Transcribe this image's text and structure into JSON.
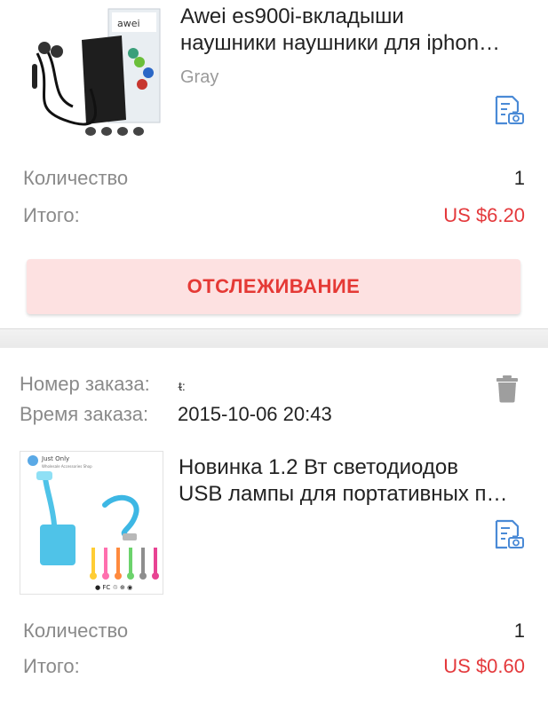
{
  "order1": {
    "product_title": "Awei es900i-вкладыши наушники наушники для iphone",
    "title_line1": "Awei es900i-вкладыши",
    "title_line2": "наушники наушники для iphon…",
    "variant": "Gray",
    "qty_label": "Количество",
    "qty_value": "1",
    "total_label": "Итого:",
    "total_value": "US $6.20",
    "track_label": "ОТСЛЕЖИВАНИЕ"
  },
  "order2": {
    "order_number_label": "Номер заказа:",
    "order_number_value": "",
    "order_time_label": "Время заказа:",
    "order_time_value": "2015-10-06 20:43",
    "title_line1": "Новинка 1.2 Вт светодиодов",
    "title_line2": "USB лампы для портативных п…",
    "thumb_text": "Just Only",
    "qty_label": "Количество",
    "qty_value": "1",
    "total_label": "Итого:",
    "total_value": "US $0.60"
  },
  "colors": {
    "accent_red": "#e53935",
    "price_red": "#e4393c",
    "button_bg": "#fde1e1",
    "icon_blue": "#4a8ad6",
    "trash_gray": "#9e9e9e"
  },
  "icons": [
    "screenshot-doc-icon",
    "trash-icon"
  ]
}
